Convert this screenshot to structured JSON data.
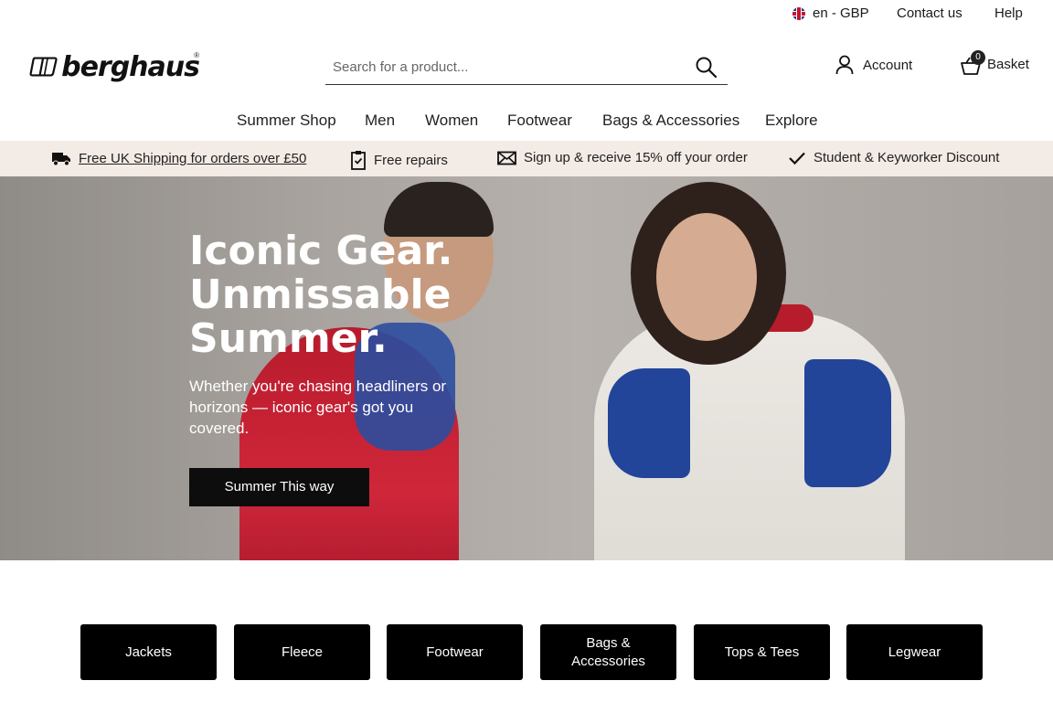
{
  "utility": {
    "locale": "en - GBP",
    "contact": "Contact us",
    "help": "Help"
  },
  "header": {
    "logo_text": "berghaus",
    "search_placeholder": "Search for a product...",
    "account_label": "Account",
    "basket_label": "Basket",
    "basket_count": "0"
  },
  "nav": {
    "items": [
      "Summer Shop",
      "Men",
      "Women",
      "Footwear",
      "Bags & Accessories",
      "Explore"
    ]
  },
  "promo": {
    "shipping": "Free UK Shipping for orders over £50",
    "repairs": "Free repairs",
    "signup": "Sign up & receive 15% off your order",
    "discount": "Student & Keyworker Discount"
  },
  "hero": {
    "title_line1": "Iconic Gear.",
    "title_line2": "Unmissable",
    "title_line3": "Summer.",
    "subtitle": "Whether you're chasing headliners or horizons — iconic gear's got you covered.",
    "cta": "Summer This way"
  },
  "categories": {
    "items": [
      "Jackets",
      "Fleece",
      "Footwear",
      "Bags & Accessories",
      "Tops & Tees",
      "Legwear"
    ]
  },
  "colors": {
    "promo_bg": "#f3ebe6",
    "cta_bg": "#0d0d0d",
    "tile_bg": "#000000"
  }
}
